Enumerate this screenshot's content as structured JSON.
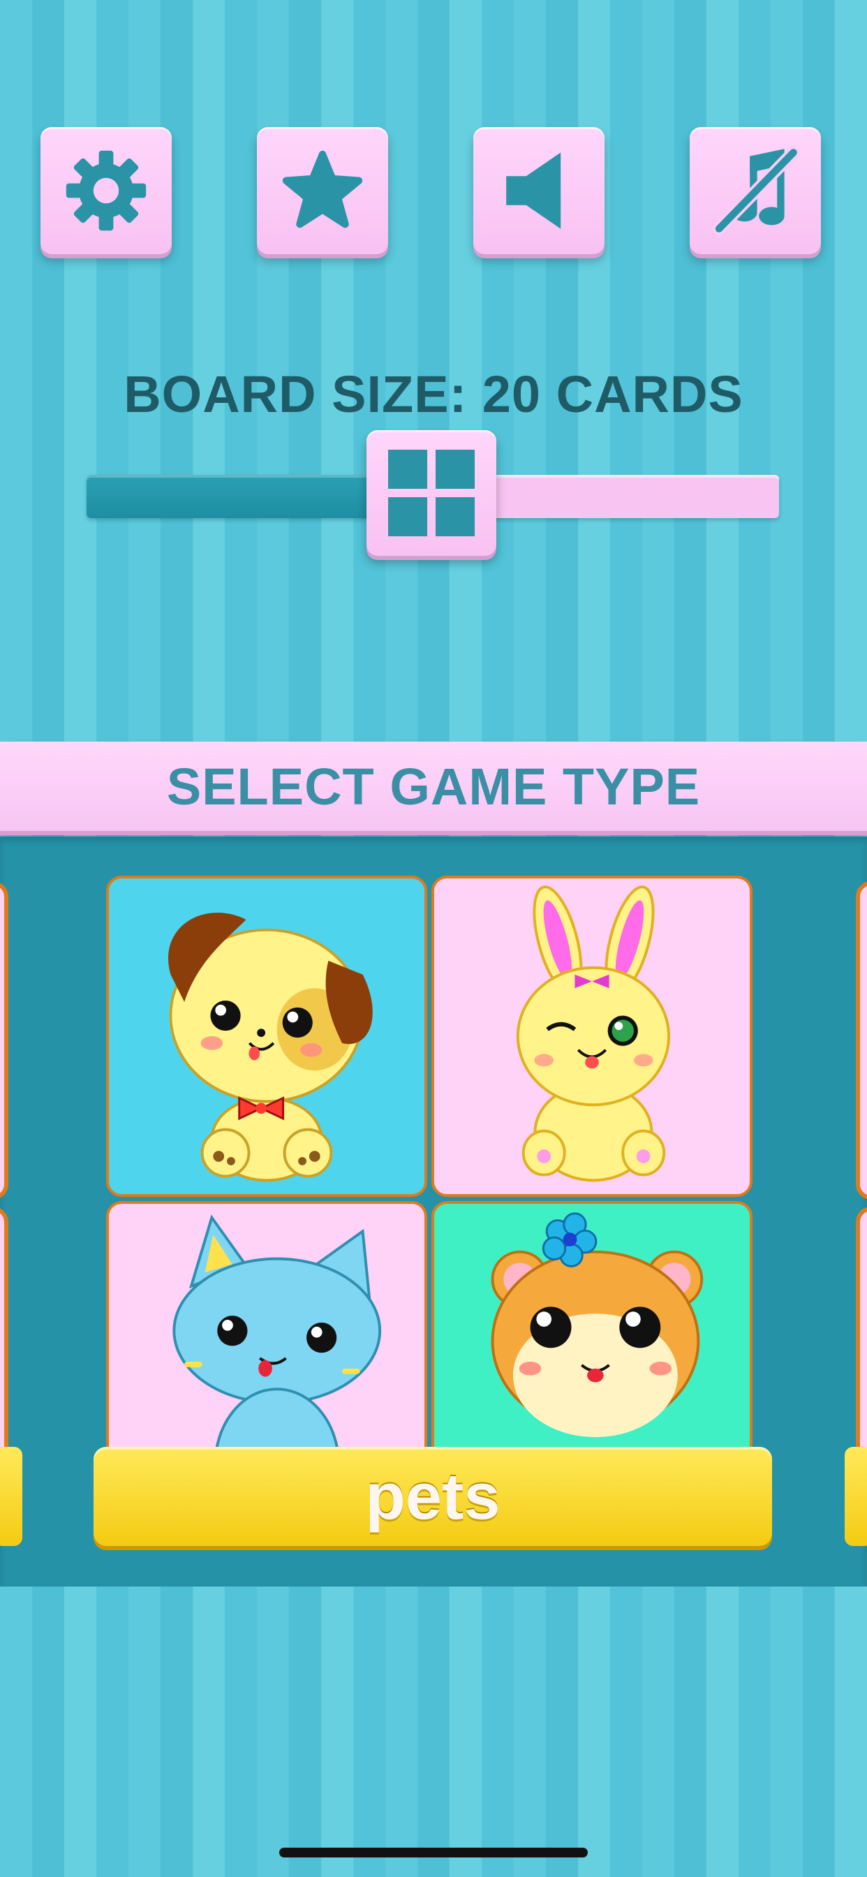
{
  "toolbar": {
    "buttons": [
      {
        "name": "settings",
        "icon": "gear-icon"
      },
      {
        "name": "favorites",
        "icon": "star-icon"
      },
      {
        "name": "sound",
        "icon": "speaker-icon"
      },
      {
        "name": "music",
        "icon": "music-muted-icon"
      }
    ],
    "icon_color": "#2a93a6"
  },
  "board_size": {
    "title": "BOARD SIZE:  20  CARDS",
    "slider_fraction": 0.5,
    "thumb_icon": "grid-icon"
  },
  "game_type": {
    "heading": "SELECT GAME TYPE",
    "selected_label": "pets",
    "cards": [
      {
        "animal": "puppy",
        "background": "#4fd4ee"
      },
      {
        "animal": "bunny",
        "background": "#ffd2f8"
      },
      {
        "animal": "kitten",
        "background": "#ffd2f8"
      },
      {
        "animal": "hamster",
        "background": "#3ef0c4"
      }
    ]
  },
  "colors": {
    "accent_teal": "#2592a8",
    "pink": "#f8c2f2",
    "label_yellow": "#f4cb12"
  }
}
